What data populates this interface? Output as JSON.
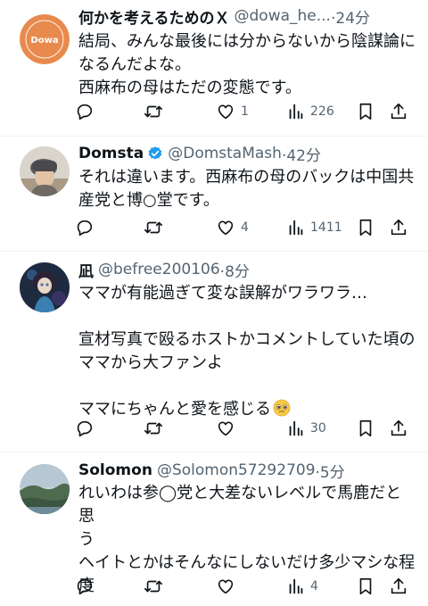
{
  "tweets": [
    {
      "name": "何かを考えるためのＸ",
      "handle": "@dowa_he...",
      "time": "·24分",
      "verified": false,
      "avatar_label": "Dowa",
      "lines": [
        "結局、みんな最後には分からないから陰謀論に",
        "なるんだよな。",
        "西麻布の母はただの変態です。"
      ],
      "replies": "",
      "reposts": "",
      "likes": "1",
      "views": "226"
    },
    {
      "name": "Domsta",
      "handle": "@DomstaMash",
      "time": "·42分",
      "verified": true,
      "lines": [
        "それは違います。西麻布の母のバックは中国共",
        "産党と博○堂です。"
      ],
      "replies": "",
      "reposts": "",
      "likes": "4",
      "views": "1411"
    },
    {
      "name": "凪",
      "handle": "@befree200106",
      "time": "·8分",
      "verified": false,
      "lines": [
        "ママが有能過ぎて変な誤解がワラワラ…",
        "",
        "宣材写真で殴るホストかコメントしていた頃の",
        "ママから大ファンよ",
        "",
        "ママにちゃんと愛を感じる"
      ],
      "replies": "",
      "reposts": "",
      "likes": "",
      "views": "30"
    },
    {
      "name": "Solomon",
      "handle": "@Solomon57292709",
      "time": "·5分",
      "verified": false,
      "lines": [
        "れいわは参◯党と大差ないレベルで馬鹿だと思",
        "う",
        "ヘイトとかはそんなにしないだけ多少マシな程",
        "度"
      ],
      "replies": "",
      "reposts": "",
      "likes": "",
      "views": "4"
    }
  ],
  "icons": {
    "reply": "reply-icon",
    "repost": "repost-icon",
    "like": "heart-icon",
    "views": "views-icon",
    "bookmark": "bookmark-icon",
    "share": "share-icon",
    "verified": "verified-badge-icon",
    "emoji": "pleading-face-emoji"
  },
  "colors": {
    "text": "#0f1419",
    "secondary": "#536471",
    "verified": "#1d9bf0",
    "avatar1": "#e88a4d",
    "divider": "#eff3f4"
  }
}
